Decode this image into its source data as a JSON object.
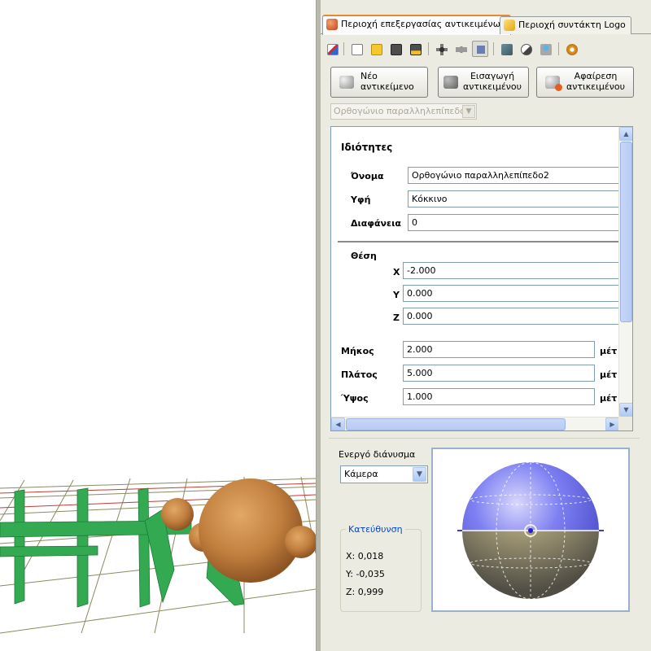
{
  "tabs": [
    {
      "label": "Περιοχή επεξεργασίας αντικειμένων",
      "active": true
    },
    {
      "label": "Περιοχή συντάκτη Logo",
      "active": false
    }
  ],
  "toolbar_icons": [
    "chart-icon",
    "new-file-icon",
    "open-folder-icon",
    "save-icon",
    "save-as-icon",
    "move-icon",
    "camera-view-icon",
    "frame-view-icon",
    "screenshot-icon",
    "texture-icon",
    "material-icon",
    "settings-icon"
  ],
  "buttons": {
    "new_object": "Νέο αντικείμενο",
    "import_object": "Εισαγωγή αντικειμένου",
    "remove_object": "Αφαίρεση αντικειμένου"
  },
  "object_type_select": "Ορθογώνιο παραλληλεπίπεδο",
  "properties": {
    "heading": "Ιδιότητες",
    "name_label": "Όνομα",
    "name_value": "Ορθογώνιο παραλληλεπίπεδο2",
    "texture_label": "Υφή",
    "texture_value": "Κόκκινο",
    "transparency_label": "Διαφάνεια",
    "transparency_value": "0",
    "position_label": "Θέση",
    "x_label": "X",
    "x_value": "-2.000",
    "y_label": "Y",
    "y_value": "0.000",
    "z_label": "Z",
    "z_value": "0.000",
    "length_label": "Μήκος",
    "length_value": "2.000",
    "width_label": "Πλάτος",
    "width_value": "5.000",
    "height_label": "Ύψος",
    "height_value": "1.000",
    "unit_label": "μέτ"
  },
  "active_vector": {
    "label": "Ενεργό διάνυσμα",
    "selected": "Κάμερα"
  },
  "direction": {
    "legend": "Κατεύθυνση",
    "x": "X: 0,018",
    "y": "Y: -0,035",
    "z": "Z: 0,999"
  },
  "colors": {
    "tab_active_accent": "#e68b2c",
    "sphere_top": "#6a6cf0",
    "sphere_bottom": "#8a8261",
    "rails": "#2fa34e",
    "wood": "#c98a48"
  }
}
